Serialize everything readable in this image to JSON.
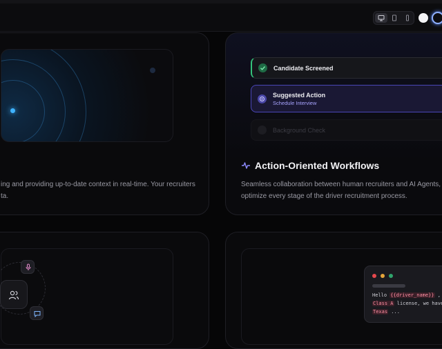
{
  "topbar": {
    "device_options": [
      "desktop-icon",
      "tablet-icon",
      "mobile-icon"
    ],
    "selected_device": "desktop",
    "theme_options": [
      "light",
      "dark"
    ],
    "selected_theme": "dark"
  },
  "cards": {
    "realtime": {
      "description_line1": "ing and providing up-to-date context in real-time. Your recruiters",
      "description_line2": "ta."
    },
    "workflows": {
      "steps": [
        {
          "label": "Candidate Screened",
          "status": "done",
          "sub": ""
        },
        {
          "label": "Suggested Action",
          "status": "active",
          "sub": "Schedule Interview"
        },
        {
          "label": "Background Check",
          "status": "pending",
          "sub": ""
        }
      ],
      "title": "Action-Oriented Workflows",
      "description_line1": "Seamless collaboration between human recruiters and AI Agents, guid",
      "description_line2": "optimize every stage of the driver recruitment process."
    },
    "collaboration": {
      "hub_icon": "users-icon",
      "satellite_icons": [
        "microphone-icon",
        "chat-icon"
      ]
    },
    "templates": {
      "code_lines": [
        {
          "parts": [
            {
              "t": "Hello ",
              "tok": false
            },
            {
              "t": "{{driver_name}}",
              "tok": true
            },
            {
              "t": " , ba",
              "tok": false
            }
          ]
        },
        {
          "parts": [
            {
              "t": "Class A",
              "tok": true
            },
            {
              "t": " license, we have",
              "tok": false
            }
          ]
        },
        {
          "parts": [
            {
              "t": "Texas",
              "tok": true
            },
            {
              "t": " ...",
              "tok": false
            }
          ]
        }
      ]
    }
  },
  "colors": {
    "accent_blue": "#3fb3ff",
    "success_green": "#34c27a",
    "accent_purple": "#6b63ff",
    "token_pink": "#ff8fa3"
  }
}
